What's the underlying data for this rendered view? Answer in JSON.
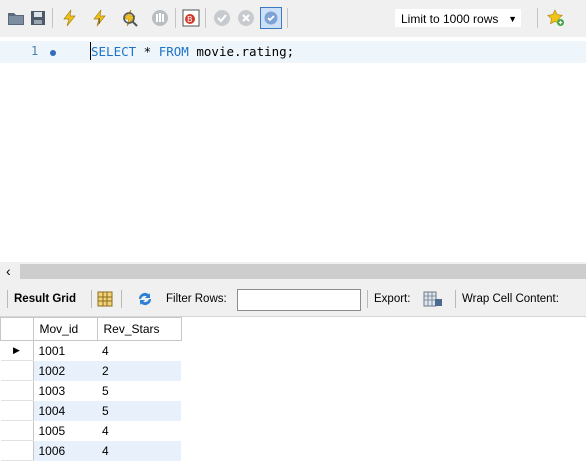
{
  "toolbar": {
    "limit_select": {
      "label": "Limit to 1000 rows"
    },
    "icons": [
      "folder-icon",
      "save-icon",
      "execute-icon",
      "execute-current-icon",
      "explain-icon",
      "stop-icon",
      "toggle-continue-on-error-icon",
      "commit-icon",
      "rollback-icon",
      "autocommit-icon",
      "add-snippet-icon"
    ],
    "colors": {
      "lightning": "#f0c21a",
      "accent_blue": "#1e73c8"
    }
  },
  "editor": {
    "line_number": "1",
    "query": {
      "kw1": "SELECT",
      "star": " * ",
      "kw2": "FROM",
      "rest": " movie.rating;"
    }
  },
  "result_toolbar": {
    "result_grid_label": "Result Grid",
    "filter_label": "Filter Rows:",
    "filter_value": "",
    "export_label": "Export:",
    "wrap_label": "Wrap Cell Content:"
  },
  "grid": {
    "columns": [
      "Mov_id",
      "Rev_Stars"
    ],
    "rows": [
      [
        "1001",
        "4"
      ],
      [
        "1002",
        "2"
      ],
      [
        "1003",
        "5"
      ],
      [
        "1004",
        "5"
      ],
      [
        "1005",
        "4"
      ],
      [
        "1006",
        "4"
      ]
    ],
    "row_indicator": "▶"
  }
}
